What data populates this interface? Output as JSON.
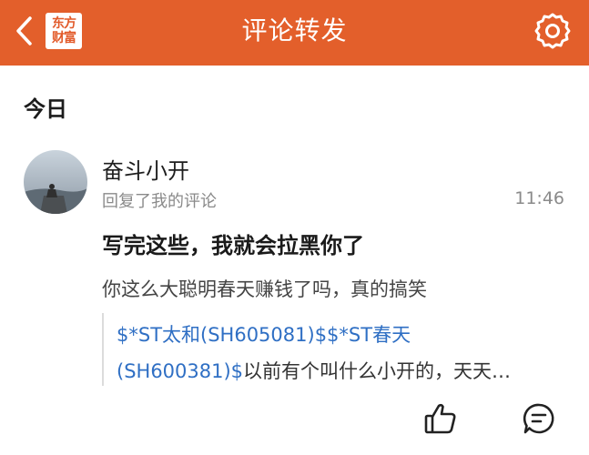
{
  "header": {
    "title": "评论转发",
    "logo_line1": "东方",
    "logo_line2": "财富",
    "accent_color": "#e35f2b",
    "back_icon": "chevron-left-icon",
    "settings_icon": "gear-icon"
  },
  "section": {
    "title": "今日"
  },
  "notification": {
    "username": "奋斗小开",
    "action": "回复了我的评论",
    "time": "11:46",
    "reply": "写完这些，我就会拉黑你了",
    "original_comment": "你这么大聪明春天赚钱了吗，真的搞笑",
    "quote": {
      "line1_link": "$*ST太和(SH605081)$$*ST春天",
      "line2_link": "(SH600381)$",
      "line2_text": "以前有个叫什么小开的，天天…"
    },
    "actions": {
      "like_icon": "thumbs-up-icon",
      "comment_icon": "comment-icon"
    }
  }
}
